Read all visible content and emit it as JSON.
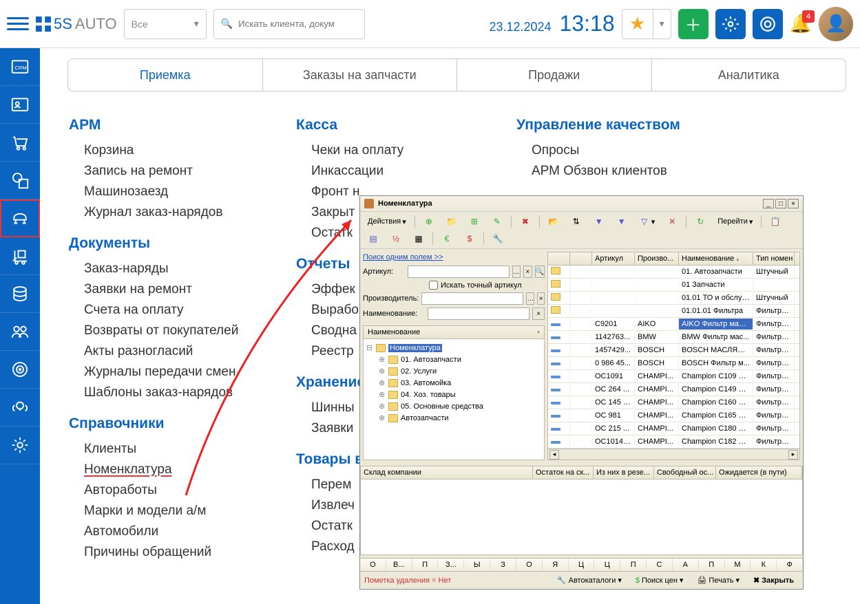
{
  "header": {
    "logo_bold": "5S",
    "logo_light": "AUTO",
    "filter_label": "Все",
    "search_placeholder": "Искать клиента, докум",
    "date": "23.12.2024",
    "time": "13:18",
    "badge_count": "4"
  },
  "tabs": [
    "Приемка",
    "Заказы на запчасти",
    "Продажи",
    "Аналитика"
  ],
  "menus": {
    "col1": [
      {
        "title": "АРМ",
        "items": [
          "Корзина",
          "Запись на ремонт",
          "Машинозаезд",
          "Журнал заказ-нарядов"
        ]
      },
      {
        "title": "Документы",
        "items": [
          "Заказ-наряды",
          "Заявки на ремонт",
          "Счета на оплату",
          "Возвраты от покупателей",
          "Акты разногласий",
          "Журналы передачи смен",
          "Шаблоны заказ-нарядов"
        ]
      },
      {
        "title": "Справочники",
        "items": [
          "Клиенты",
          "Номенклатура",
          "Автоработы",
          "Марки и модели а/м",
          "Автомобили",
          "Причины обращений"
        ]
      }
    ],
    "col2": [
      {
        "title": "Касса",
        "items": [
          "Чеки на оплату",
          "Инкассации",
          "Фронт н",
          "Закрыт",
          "Остатк"
        ]
      },
      {
        "title": "Отчеты",
        "items": [
          "Эффек",
          "Вырабо",
          "Сводна",
          "Реестр"
        ]
      },
      {
        "title": "Хранение",
        "items": [
          "Шинны",
          "Заявки"
        ]
      },
      {
        "title": "Товары в",
        "items": [
          "Перем",
          "Извлеч",
          "Остатк",
          "Расход"
        ]
      }
    ],
    "col3": [
      {
        "title": "Управление качеством",
        "items": [
          "Опросы",
          "АРМ Обзвон клиентов"
        ]
      }
    ]
  },
  "dialog": {
    "title": "Номенклатура",
    "actions_label": "Действия",
    "goto_label": "Перейти",
    "search_link": "Поиск одним полем >>",
    "form": {
      "article_label": "Артикул:",
      "exact_label": "Искать точный артикул",
      "manufacturer_label": "Производитель:",
      "name_label": "Наименование:"
    },
    "tree_header": "Наименование",
    "tree_root": "Номенклатура",
    "tree_items": [
      "01. Автозапчасти",
      "02. Услуги",
      "03. Автомойка",
      "04. Хоз. товары",
      "05. Основные средства",
      "Автозапчасти"
    ],
    "grid_headers": {
      "article": "Артикул",
      "manufacturer": "Произво...",
      "name": "Наименование",
      "type": "Тип номен"
    },
    "rows": [
      {
        "folder": true,
        "article": "",
        "manufacturer": "",
        "name": "01. Автозапчасти",
        "type": "Штучный"
      },
      {
        "folder": true,
        "article": "",
        "manufacturer": "",
        "name": "01 Запчасти",
        "type": ""
      },
      {
        "folder": true,
        "article": "",
        "manufacturer": "",
        "name": "01.01 ТО и обслуж...",
        "type": "Штучный"
      },
      {
        "folder": true,
        "article": "",
        "manufacturer": "",
        "name": "01.01.01 Фильтра",
        "type": "Фильтр м..."
      },
      {
        "folder": false,
        "article": "C9201",
        "manufacturer": "AIKO",
        "name": "AIKO Фильтр масл...",
        "type": "Фильтр м...",
        "selected": true
      },
      {
        "folder": false,
        "article": "1142763...",
        "manufacturer": "BMW",
        "name": "BMW Фильтр мас...",
        "type": "Фильтр м..."
      },
      {
        "folder": false,
        "article": "1457429...",
        "manufacturer": "BOSCH",
        "name": "BOSCH МАСЛЯНЫ...",
        "type": "Фильтр м..."
      },
      {
        "folder": false,
        "article": "0 986 45...",
        "manufacturer": "BOSCH",
        "name": "BOSCH Фильтр м...",
        "type": "Фильтр м..."
      },
      {
        "folder": false,
        "article": "OC1091",
        "manufacturer": "CHAMPI...",
        "name": "Champion C109 Фи...",
        "type": "Фильтр м..."
      },
      {
        "folder": false,
        "article": "OC 264 ...",
        "manufacturer": "CHAMPI...",
        "name": "Champion C149 Фи...",
        "type": "Фильтр м..."
      },
      {
        "folder": false,
        "article": "OC 145 O...",
        "manufacturer": "CHAMPI...",
        "name": "Champion C160 Фи...",
        "type": "Фильтр м..."
      },
      {
        "folder": false,
        "article": "OC 981",
        "manufacturer": "CHAMPI...",
        "name": "Champion C165 Фи...",
        "type": "Фильтр м..."
      },
      {
        "folder": false,
        "article": "OC 215 ...",
        "manufacturer": "CHAMPI...",
        "name": "Champion C180 Фи...",
        "type": "Фильтр м..."
      },
      {
        "folder": false,
        "article": "OC1014 ...",
        "manufacturer": "CHAMPI...",
        "name": "Champion C182 Фи...",
        "type": "Фильтр м..."
      }
    ],
    "lower_headers": [
      "Склад компании",
      "Остаток на ск...",
      "Из них в резе...",
      "Свободный ос...",
      "Ожидается (в пути)"
    ],
    "alpha": [
      "О",
      "В...",
      "П",
      "З...",
      "Ы",
      "З",
      "О",
      "Я",
      "Ц",
      "Ц",
      "П",
      "С",
      "А",
      "П",
      "М",
      "К",
      "Ф"
    ],
    "delete_note": "Пометка удаления = Нет",
    "autocatalogs": "Автокаталоги",
    "price_search": "Поиск цен",
    "print": "Печать",
    "close": "Закрыть"
  }
}
